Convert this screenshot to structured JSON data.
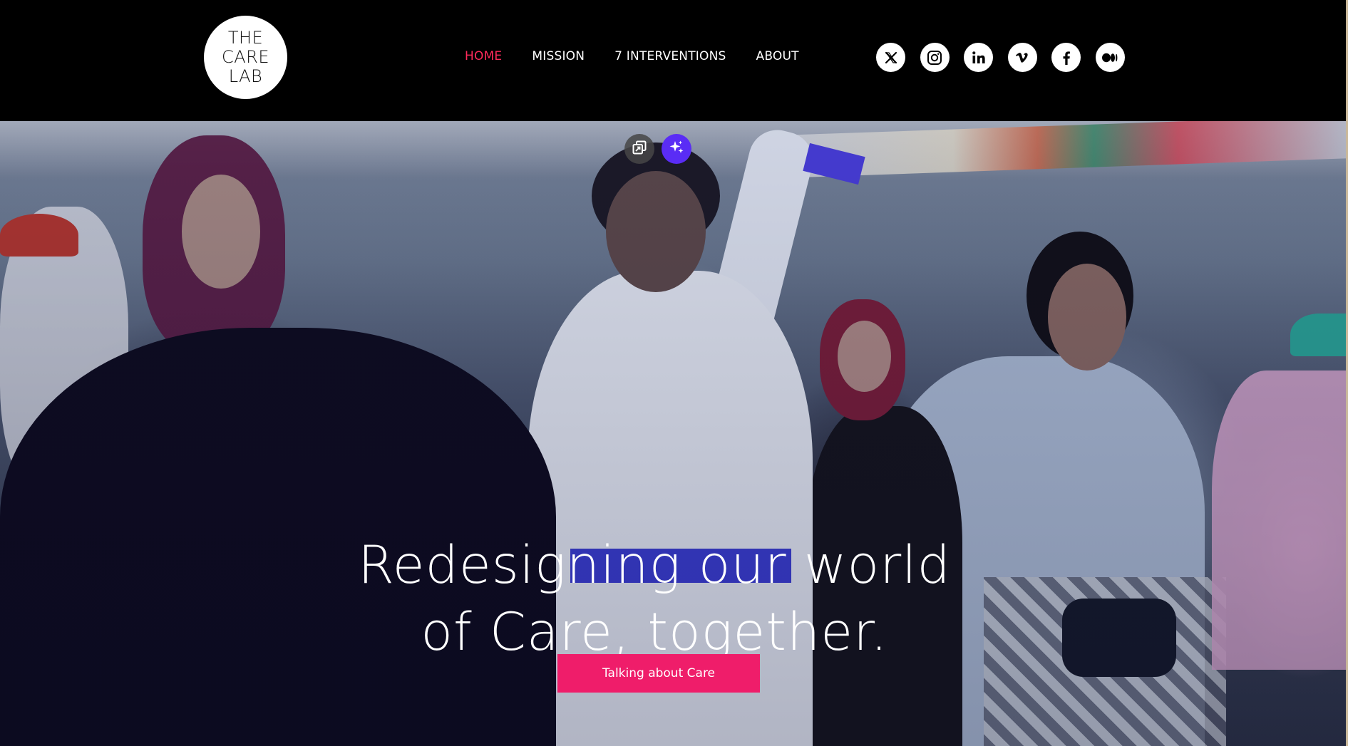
{
  "brand": {
    "logo_lines": [
      "THE",
      "CARE",
      "LAB"
    ]
  },
  "nav": {
    "items": [
      {
        "label": "HOME",
        "active": true
      },
      {
        "label": "MISSION",
        "active": false
      },
      {
        "label": "7 INTERVENTIONS",
        "active": false
      },
      {
        "label": "ABOUT",
        "active": false
      }
    ]
  },
  "social": {
    "icons": [
      "x-icon",
      "instagram-icon",
      "linkedin-icon",
      "vimeo-icon",
      "facebook-icon",
      "medium-icon"
    ]
  },
  "hero": {
    "headline_line1": "Redesigning our world",
    "headline_line2": "of Care, together.",
    "cta_label": "Talking about Care"
  },
  "editor_tools": {
    "icons": [
      "duplicate-icon",
      "ai-sparkle-icon"
    ]
  },
  "colors": {
    "nav_active": "#ff2a5b",
    "cta_bg": "#ef1d6a",
    "header_bg": "#000000",
    "ai_button": "#5a2cf5"
  }
}
